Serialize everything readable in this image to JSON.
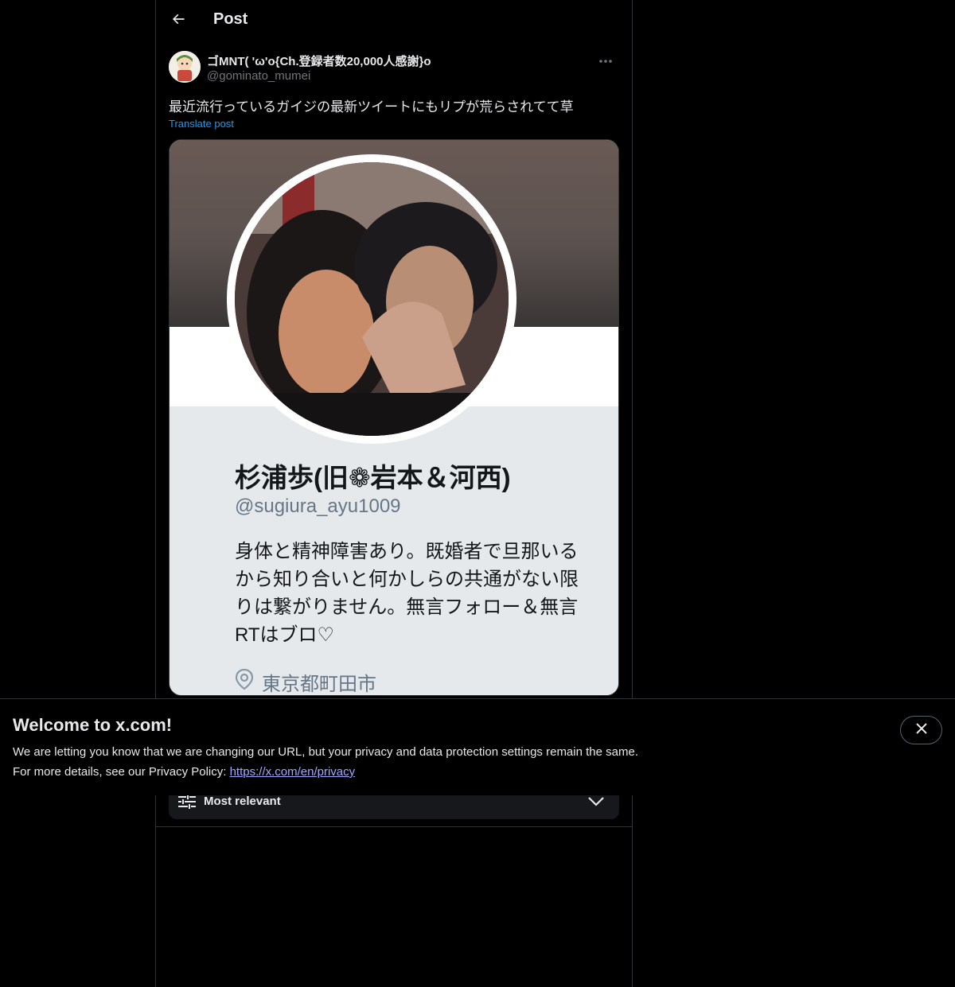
{
  "header": {
    "title": "Post",
    "back_icon": "arrow-left-icon"
  },
  "post": {
    "author_name": "ゴMNT( 'ω'o{Ch.登録者数20,000人感謝}o",
    "author_handle": "@gominato_mumei",
    "text": "最近流行っているガイジの最新ツイートにもリプが荒らされてて草",
    "translate_label": "Translate post",
    "more_icon": "ellipsis-icon"
  },
  "media": {
    "profile_name": "杉浦歩(旧❁岩本＆河西)",
    "profile_handle": "@sugiura_ayu1009",
    "profile_bio": "身体と精神障害あり。既婚者で旦那いるから知り合いと何かしらの共通がない限りは繋がりません。無言フォロー＆無言RTはブロ♡",
    "profile_location": "東京都町田市",
    "location_icon": "location-pin-icon"
  },
  "replies": {
    "sort_label": "Most relevant",
    "sort_icon": "sliders-icon",
    "chevron_icon": "chevron-down-icon"
  },
  "banner": {
    "title": "Welcome to x.com!",
    "line1": "We are letting you know that we are changing our URL, but your privacy and data protection settings remain the same.",
    "line2_prefix": "For more details, see our Privacy Policy: ",
    "link_text": "https://x.com/en/privacy",
    "close_icon": "close-icon"
  },
  "colors": {
    "background": "#000000",
    "text": "#e7e9ea",
    "muted": "#71767b",
    "accent": "#1d9bf0",
    "link": "#a3a8ff",
    "border": "#2f3336"
  }
}
